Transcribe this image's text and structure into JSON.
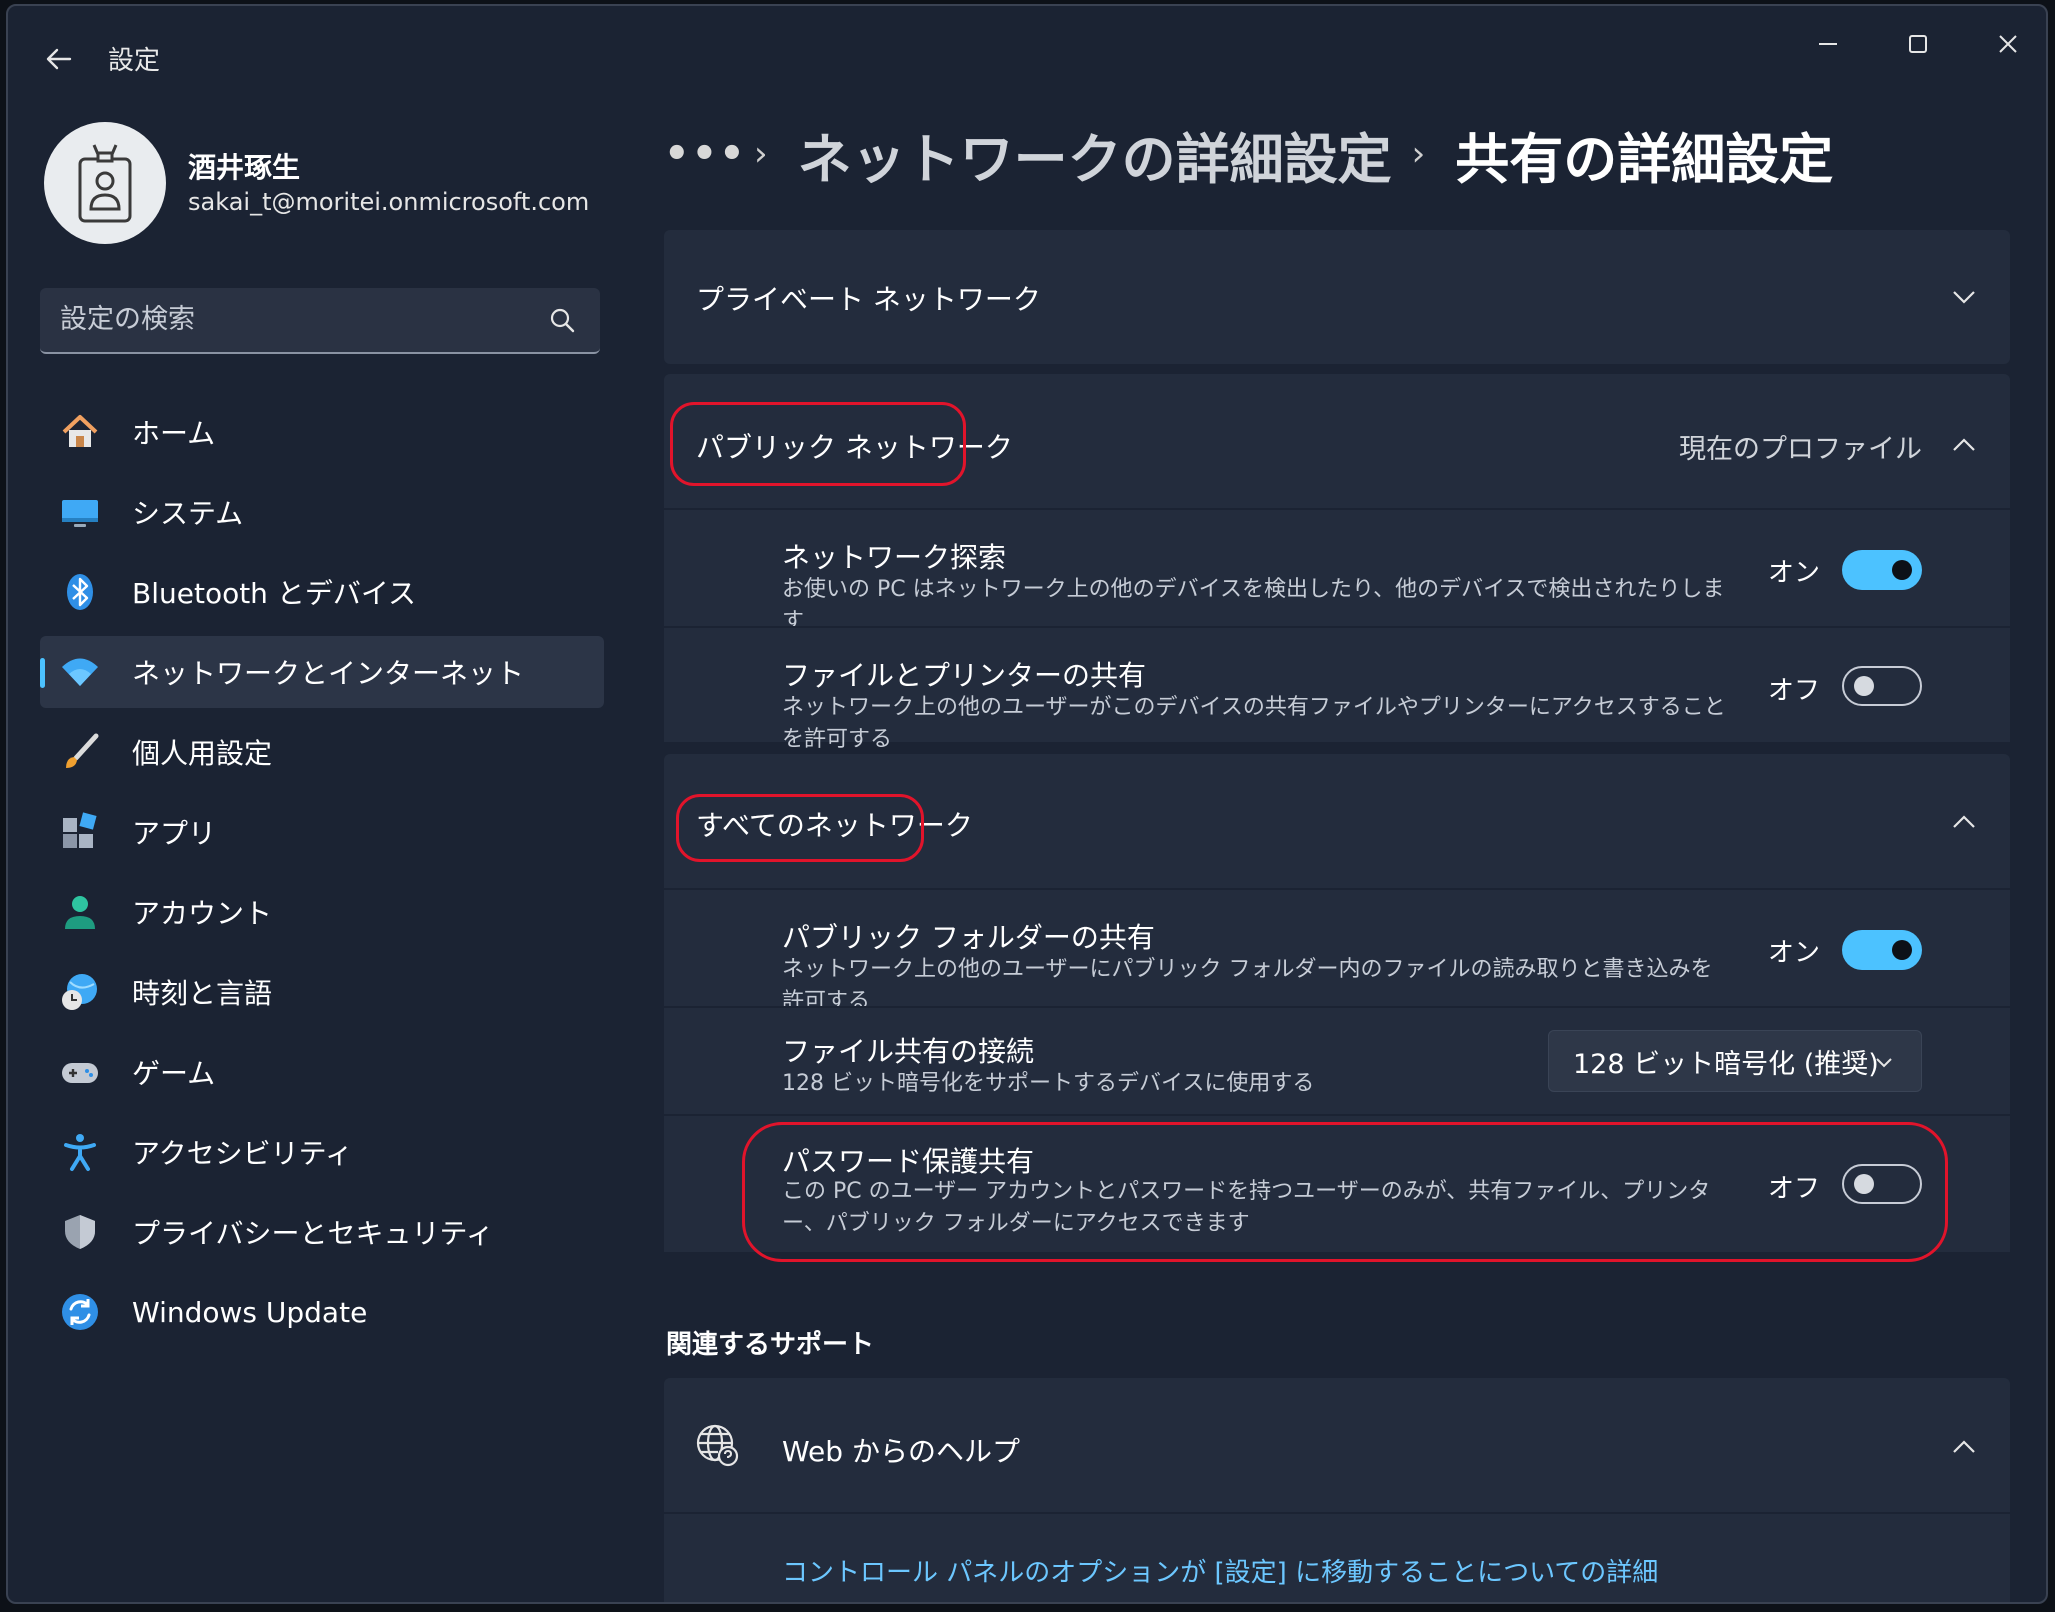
{
  "window": {
    "title": "設定"
  },
  "profile": {
    "name": "酒井琢生",
    "email": "sakai_t@moritei.onmicrosoft.com"
  },
  "search": {
    "placeholder": "設定の検索"
  },
  "nav": {
    "items": [
      {
        "label": "ホーム",
        "icon": "home-icon"
      },
      {
        "label": "システム",
        "icon": "system-icon"
      },
      {
        "label": "Bluetooth とデバイス",
        "icon": "bluetooth-icon"
      },
      {
        "label": "ネットワークとインターネット",
        "icon": "wifi-icon",
        "active": true
      },
      {
        "label": "個人用設定",
        "icon": "brush-icon"
      },
      {
        "label": "アプリ",
        "icon": "apps-icon"
      },
      {
        "label": "アカウント",
        "icon": "account-icon"
      },
      {
        "label": "時刻と言語",
        "icon": "globe-clock-icon"
      },
      {
        "label": "ゲーム",
        "icon": "gamepad-icon"
      },
      {
        "label": "アクセシビリティ",
        "icon": "accessibility-icon"
      },
      {
        "label": "プライバシーとセキュリティ",
        "icon": "shield-icon"
      },
      {
        "label": "Windows Update",
        "icon": "update-icon"
      }
    ]
  },
  "breadcrumb": {
    "more": "•••",
    "parent": "ネットワークの詳細設定",
    "current": "共有の詳細設定"
  },
  "private_network": {
    "label": "プライベート ネットワーク"
  },
  "public_network": {
    "label": "パブリック ネットワーク",
    "profile_label": "現在のプロファイル",
    "discovery": {
      "title": "ネットワーク探索",
      "desc": "お使いの PC はネットワーク上の他のデバイスを検出したり、他のデバイスで検出されたりします",
      "state": "オン",
      "on": true
    },
    "file_printer": {
      "title": "ファイルとプリンターの共有",
      "desc": "ネットワーク上の他のユーザーがこのデバイスの共有ファイルやプリンターにアクセスすることを許可する",
      "state": "オフ",
      "on": false
    }
  },
  "all_networks": {
    "label": "すべてのネットワーク",
    "public_folder": {
      "title": "パブリック フォルダーの共有",
      "desc": "ネットワーク上の他のユーザーにパブリック フォルダー内のファイルの読み取りと書き込みを許可する",
      "state": "オン",
      "on": true
    },
    "file_sharing_conn": {
      "title": "ファイル共有の接続",
      "desc": "128 ビット暗号化をサポートするデバイスに使用する",
      "value": "128 ビット暗号化 (推奨)"
    },
    "password_protected": {
      "title": "パスワード保護共有",
      "desc": "この PC のユーザー アカウントとパスワードを持つユーザーのみが、共有ファイル、プリンター、パブリック フォルダーにアクセスできます",
      "state": "オフ",
      "on": false
    }
  },
  "related": {
    "title": "関連するサポート",
    "web_help": "Web からのヘルプ",
    "link": "コントロール パネルのオプションが [設定] に移動することについての詳細"
  },
  "colors": {
    "accent": "#4cc2ff",
    "highlight": "#e1142b",
    "background": "#1b2333",
    "card": "#232c3d"
  }
}
